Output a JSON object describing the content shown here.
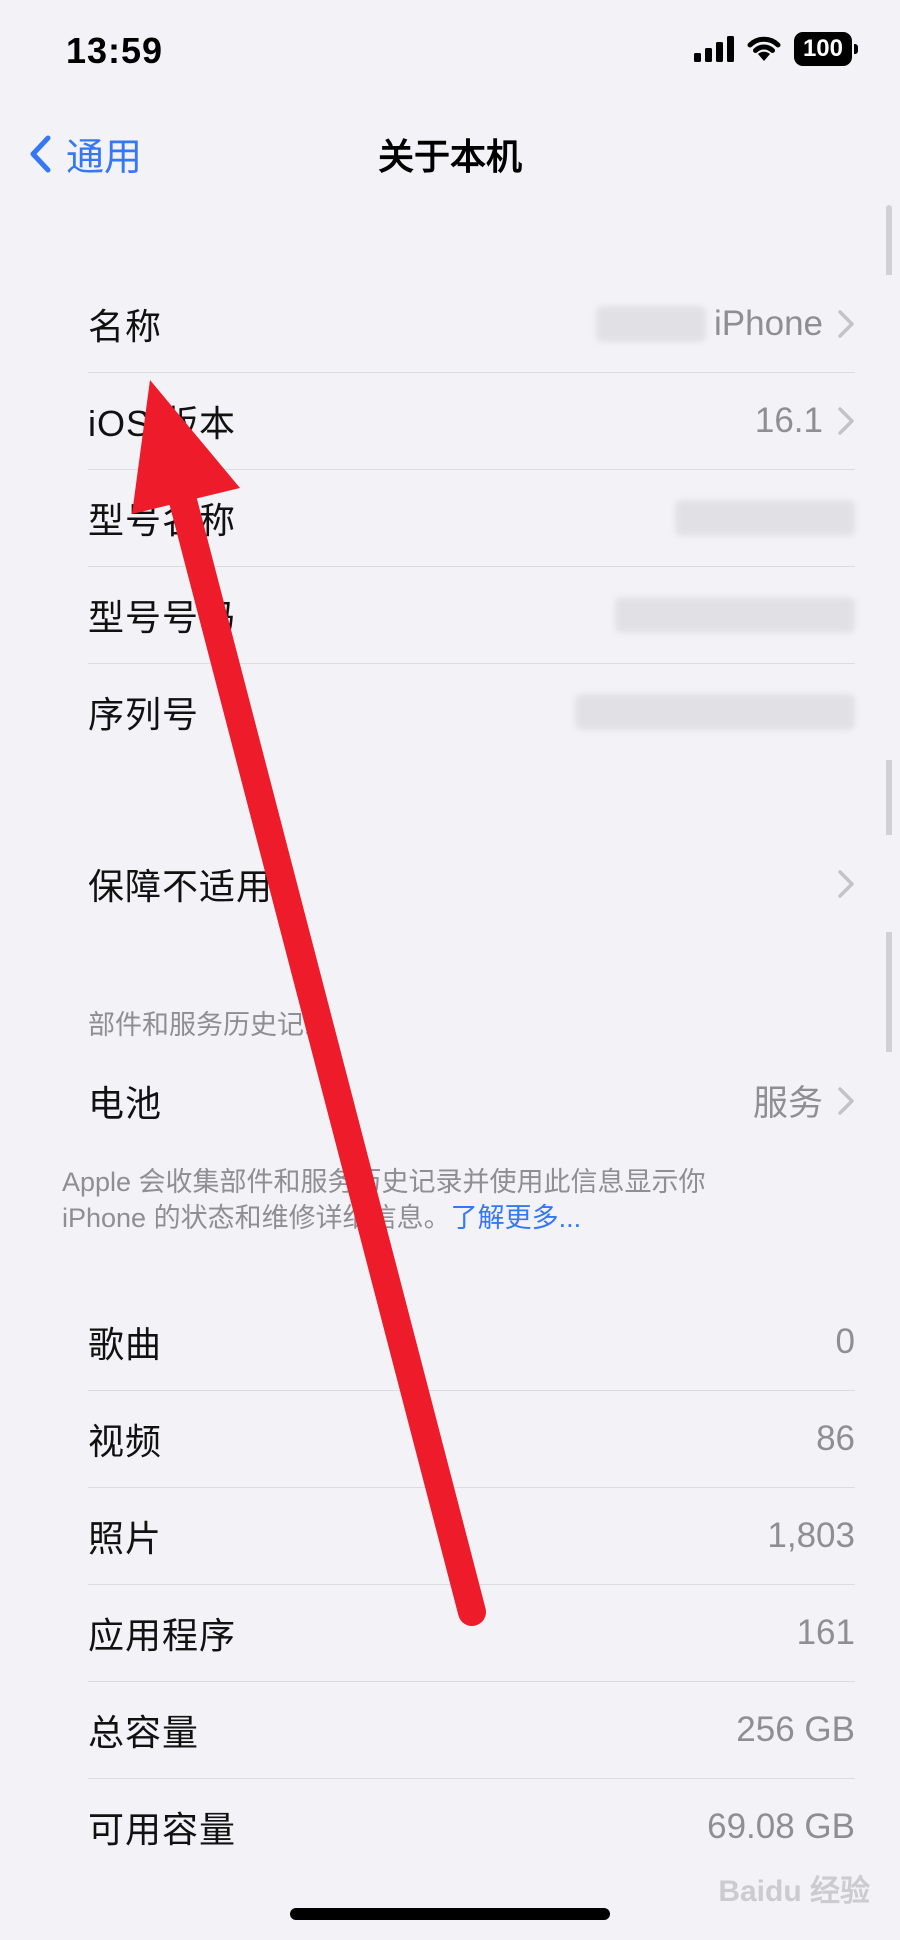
{
  "status_bar": {
    "time": "13:59",
    "battery": "100"
  },
  "nav": {
    "back_label": "通用",
    "title": "关于本机"
  },
  "device_info": {
    "rows": [
      {
        "label": "名称",
        "value": "iPhone",
        "chevron": true
      },
      {
        "label": "iOS 版本",
        "value": "16.1",
        "chevron": true
      },
      {
        "label": "型号名称",
        "value": "",
        "chevron": false
      },
      {
        "label": "型号号码",
        "value": "",
        "chevron": false
      },
      {
        "label": "序列号",
        "value": "",
        "chevron": false
      }
    ]
  },
  "warranty": {
    "label": "保障不适用"
  },
  "parts_service": {
    "header": "部件和服务历史记录",
    "battery_label": "电池",
    "battery_value": "服务",
    "footnote_text": "Apple 会收集部件和服务历史记录并使用此信息显示你iPhone 的状态和维修详细信息。",
    "footnote_link": "了解更多..."
  },
  "stats": {
    "rows": [
      {
        "label": "歌曲",
        "value": "0"
      },
      {
        "label": "视频",
        "value": "86"
      },
      {
        "label": "照片",
        "value": "1,803"
      },
      {
        "label": "应用程序",
        "value": "161"
      },
      {
        "label": "总容量",
        "value": "256 GB"
      },
      {
        "label": "可用容量",
        "value": "69.08 GB"
      }
    ]
  },
  "watermark": "Baidu 经验",
  "colors": {
    "accent": "#3478f6",
    "annotation": "#ee1c2a",
    "background": "#f2f2f7"
  }
}
